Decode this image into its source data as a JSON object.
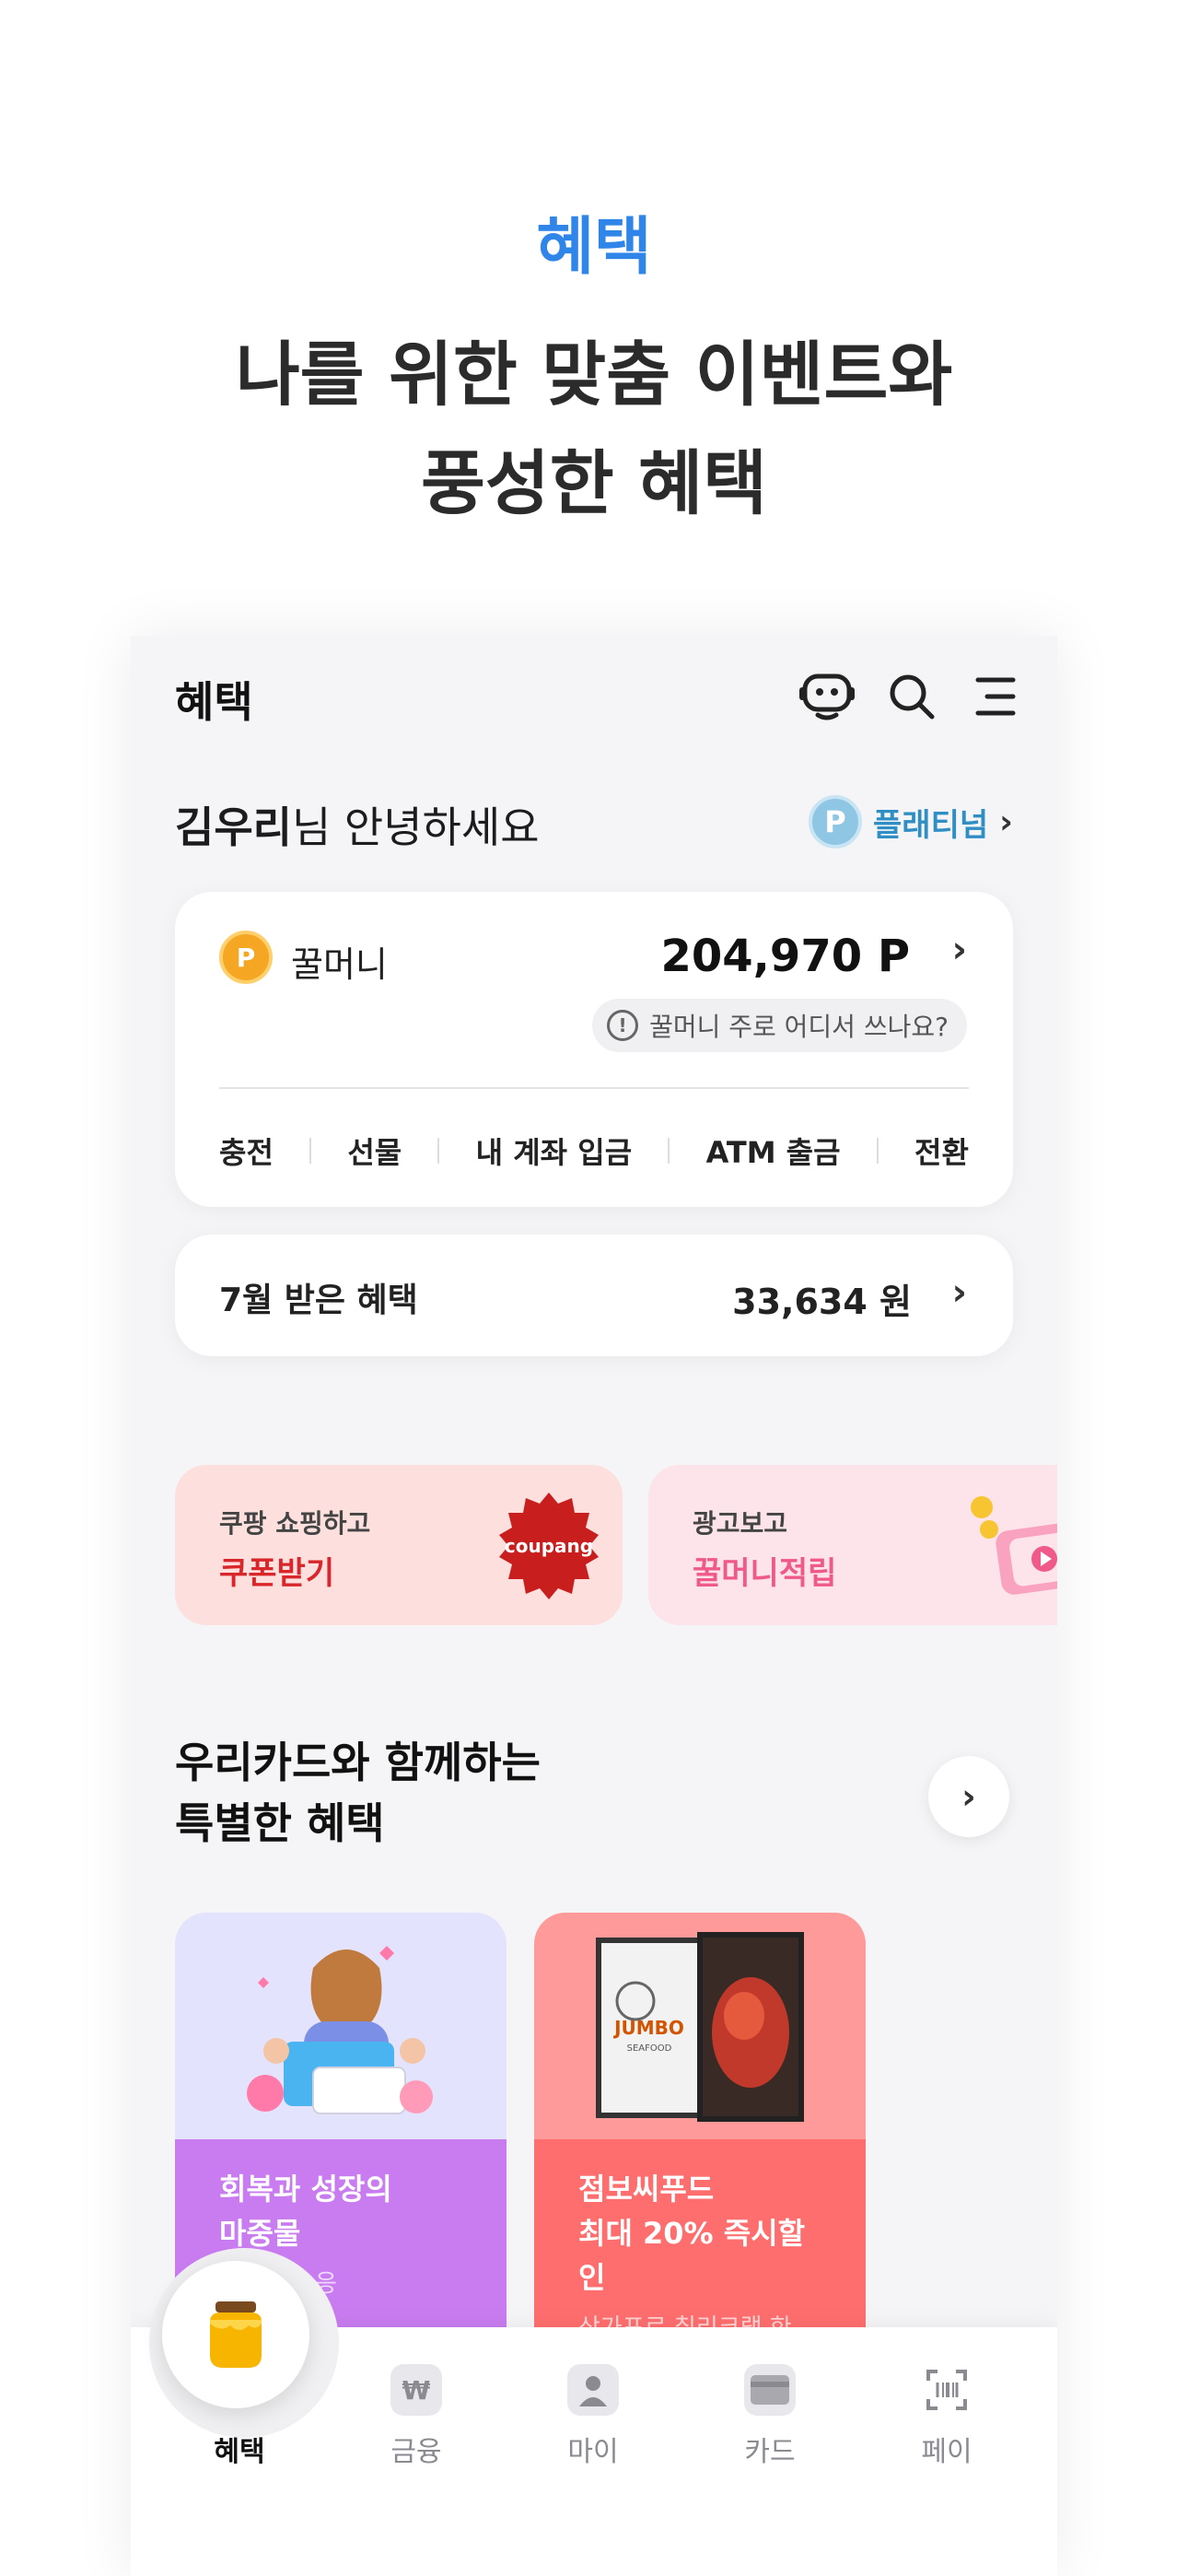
{
  "promo": {
    "kicker": "혜택",
    "headline_line1": "나를 위한 맞춤 이벤트와",
    "headline_line2": "풍성한 혜택"
  },
  "header": {
    "title": "혜택",
    "icons": [
      "chatbot-icon",
      "search-icon",
      "menu-icon"
    ]
  },
  "greeting": {
    "name": "김우리",
    "suffix": "님 안녕하세요",
    "tier_badge": "P",
    "tier_label": "플래티넘"
  },
  "honey_money": {
    "coin_letter": "P",
    "label": "꿀머니",
    "amount": "204,970 P",
    "help_text": "꿀머니 주로 어디서 쓰나요?",
    "actions": [
      "충전",
      "선물",
      "내 계좌 입금",
      "ATM 출금",
      "전환"
    ]
  },
  "monthly_benefit": {
    "label": "7월 받은 혜택",
    "amount": "33,634 원"
  },
  "banners": [
    {
      "sub": "쿠팡 쇼핑하고",
      "main": "쿠폰받기",
      "logo_text": "coupang",
      "bg": "#fde0de",
      "accent": "#d8262b"
    },
    {
      "sub": "광고보고",
      "main": "꿀머니적립",
      "bg": "#fde3ea",
      "accent": "#ef5a8a"
    }
  ],
  "section": {
    "title_line1": "우리카드와 함께하는",
    "title_line2": "특별한 혜택"
  },
  "events": [
    {
      "title": "회복과 성장의\n마중물",
      "sub": "소비쿠폰 응",
      "art_bg": "#e4e3fd",
      "body_bg": "#c97cf0"
    },
    {
      "title": "점보씨푸드\n최대 20% 즉시할\n인",
      "sub": "상가포르 칠리크랩 한",
      "logo_text": "JUMBO",
      "logo_sub": "SEAFOOD",
      "art_bg": "#ff9a9a",
      "body_bg": "#ff6e6e"
    }
  ],
  "tabbar": {
    "tabs": [
      {
        "label": "혜택",
        "icon": "honey-pot-icon",
        "active": true
      },
      {
        "label": "금융",
        "icon": "money-bag-icon",
        "active": false
      },
      {
        "label": "마이",
        "icon": "person-icon",
        "active": false
      },
      {
        "label": "카드",
        "icon": "card-icon",
        "active": false
      },
      {
        "label": "페이",
        "icon": "barcode-scan-icon",
        "active": false
      }
    ]
  },
  "colors": {
    "kicker": "#2f86e8",
    "tier": "#2f8fc4",
    "coin": "#f5a623"
  }
}
